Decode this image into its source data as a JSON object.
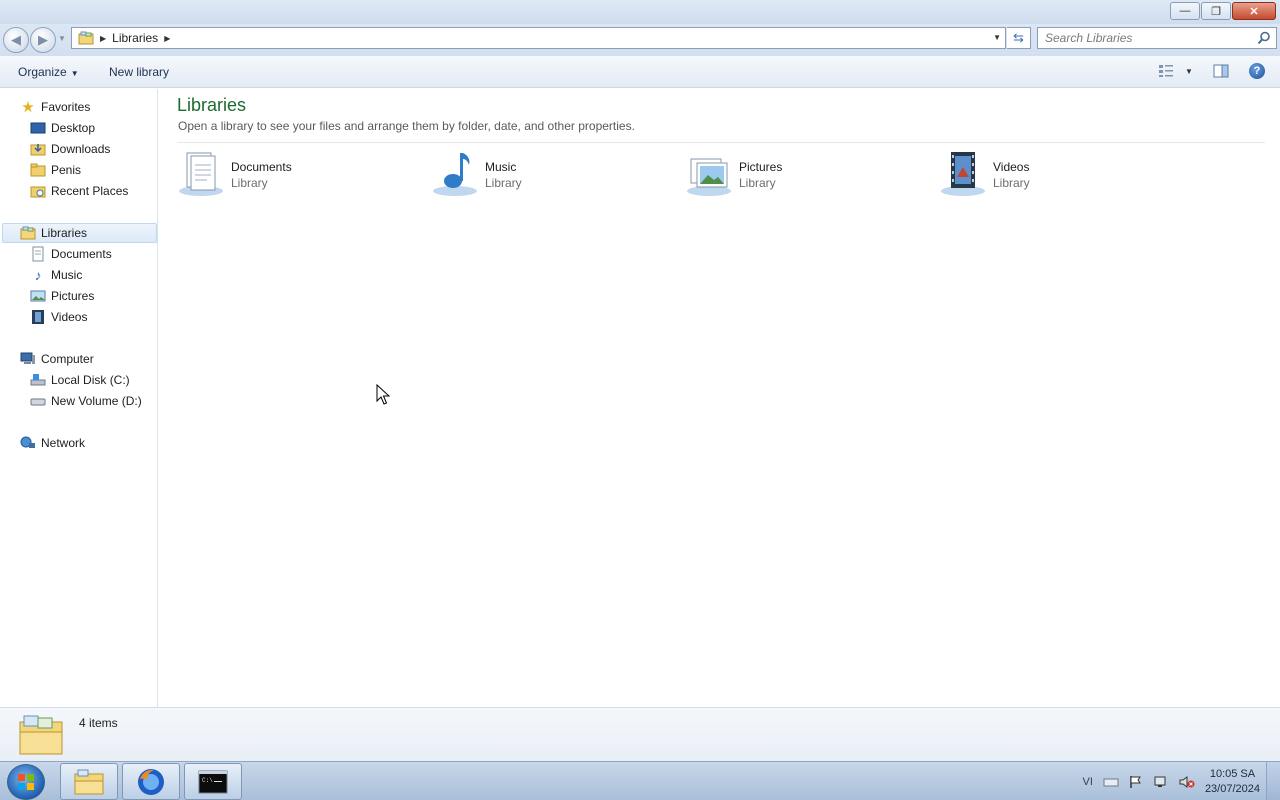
{
  "window": {
    "buttons": {
      "minimize": "—",
      "maximize": "❐",
      "close": "✕"
    }
  },
  "address": {
    "crumbs": [
      "Libraries"
    ],
    "search_placeholder": "Search Libraries"
  },
  "toolbar": {
    "organize": "Organize",
    "new_library": "New library"
  },
  "nav": {
    "favorites": {
      "label": "Favorites",
      "items": [
        "Desktop",
        "Downloads",
        "Penis",
        "Recent Places"
      ]
    },
    "libraries": {
      "label": "Libraries",
      "items": [
        "Documents",
        "Music",
        "Pictures",
        "Videos"
      ]
    },
    "computer": {
      "label": "Computer",
      "items": [
        "Local Disk (C:)",
        "New Volume (D:)"
      ]
    },
    "network": {
      "label": "Network"
    }
  },
  "content": {
    "title": "Libraries",
    "subtitle": "Open a library to see your files and arrange them by folder, date, and other properties.",
    "libraries": [
      {
        "name": "Documents",
        "kind": "Library",
        "icon": "documents-library-icon"
      },
      {
        "name": "Music",
        "kind": "Library",
        "icon": "music-library-icon"
      },
      {
        "name": "Pictures",
        "kind": "Library",
        "icon": "pictures-library-icon"
      },
      {
        "name": "Videos",
        "kind": "Library",
        "icon": "videos-library-icon"
      }
    ]
  },
  "status": {
    "item_count": "4 items"
  },
  "taskbar": {
    "language": "VI",
    "time": "10:05 SA",
    "date": "23/07/2024"
  },
  "colors": {
    "title_green": "#1e6b2e",
    "selection": "#dce9f7",
    "taskbar": "#a9bfd9"
  }
}
